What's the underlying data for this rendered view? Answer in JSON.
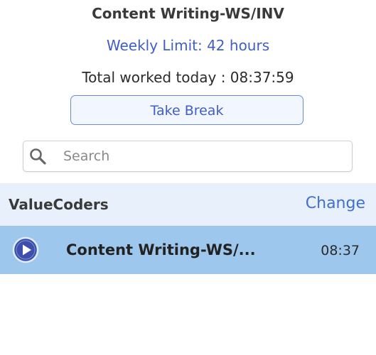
{
  "header": {
    "project_title": "Content Writing-WS/INV",
    "weekly_limit": "Weekly Limit: 42 hours",
    "total_today": "Total worked today : 08:37:59",
    "take_break_label": "Take Break"
  },
  "search": {
    "placeholder": "Search",
    "value": "",
    "icon": "search-icon"
  },
  "company": {
    "name": "ValueCoders",
    "change_label": "Change"
  },
  "projects": [
    {
      "title": "Content Writing-WS/...",
      "time": "08:37",
      "icon": "play-icon",
      "selected": true
    }
  ],
  "colors": {
    "accent": "#3f5fc7",
    "company_bar_bg": "#e7f0fb",
    "selected_row_bg": "#9ec7ee",
    "play_icon_fill": "#3d4fa8"
  }
}
